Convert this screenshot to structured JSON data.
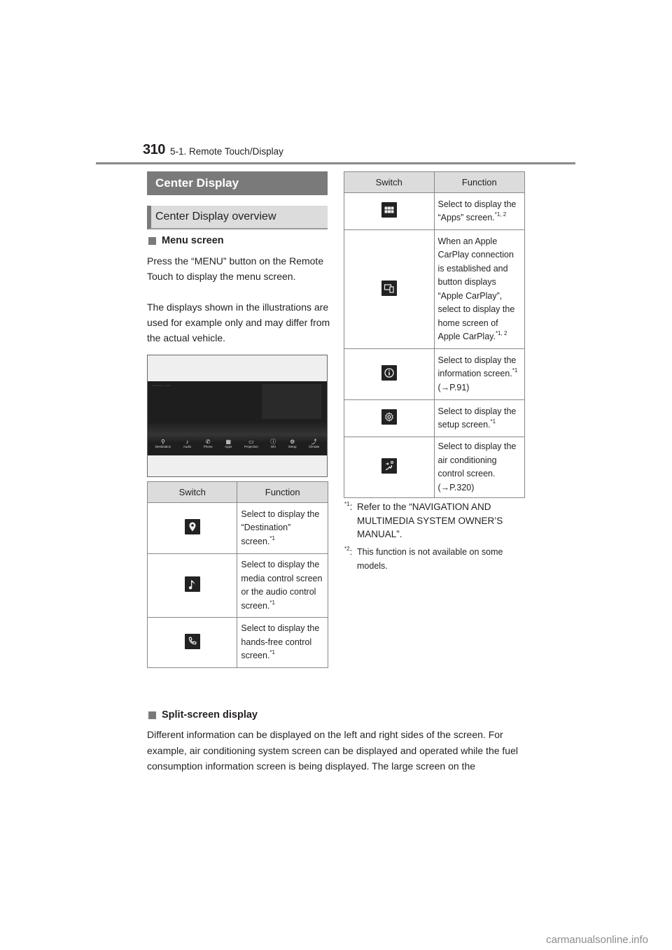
{
  "header": {
    "page_number": "310",
    "section": "5-1. Remote Touch/Display"
  },
  "headings": {
    "main": "Center Display",
    "sub": "Center Display overview"
  },
  "menu_screen": {
    "title": "Menu screen",
    "paragraph_1": "Press the “MENU” button on the Remote Touch to display the menu screen.",
    "paragraph_2": "The displays shown in the illustrations are used for example only and may differ from the actual vehicle.",
    "illustration": {
      "items": [
        {
          "label": "Destination",
          "icon": "pin-icon"
        },
        {
          "label": "Audio",
          "icon": "music-note-icon"
        },
        {
          "label": "Phone",
          "icon": "phone-icon"
        },
        {
          "label": "Apps",
          "icon": "apps-grid-icon"
        },
        {
          "label": "Projection",
          "icon": "projection-icon"
        },
        {
          "label": "Info",
          "icon": "info-icon"
        },
        {
          "label": "Setup",
          "icon": "gear-icon"
        },
        {
          "label": "Climate",
          "icon": "climate-seat-icon"
        }
      ]
    }
  },
  "table_left": {
    "headers": [
      "Switch",
      "Function"
    ],
    "rows": [
      {
        "icon": "pin-icon",
        "text": "Select to display the “Destination” screen.",
        "note": "*1"
      },
      {
        "icon": "music-note-icon",
        "text": "Select to display the media control screen or the audio control screen.",
        "note": "*1"
      },
      {
        "icon": "phone-icon",
        "text": "Select to display the hands-free control screen.",
        "note": "*1"
      }
    ]
  },
  "table_right": {
    "headers": [
      "Switch",
      "Function"
    ],
    "rows": [
      {
        "icon": "apps-grid-icon",
        "text": "Select to display the “Apps” screen.",
        "note": "*1, 2",
        "ref": ""
      },
      {
        "icon": "projection-icon",
        "text": "When an Apple CarPlay connection is established and button displays “Apple CarPlay”, select to display the home screen of Apple CarPlay.",
        "note": "*1, 2",
        "ref": ""
      },
      {
        "icon": "info-icon",
        "text": "Select to display the information screen.",
        "note": "*1",
        "ref": "(→P.91)"
      },
      {
        "icon": "gear-icon",
        "text": "Select to display the setup screen.",
        "note": "*1",
        "ref": ""
      },
      {
        "icon": "climate-seat-icon",
        "text": "Select to display the air conditioning control screen.",
        "note": "",
        "ref": "(→P.320)"
      }
    ]
  },
  "footnotes": [
    {
      "mark": "*1",
      "text": "Refer to the “NAVIGATION AND MULTIMEDIA SYSTEM OWNER’S MANUAL”."
    },
    {
      "mark": "*2",
      "text": "This function is not available on some models."
    }
  ],
  "split_screen": {
    "title": "Split-screen display",
    "paragraph": "Different information can be displayed on the left and right sides of the screen. For example, air conditioning system screen can be displayed and operated while the fuel consumption information screen is being displayed. The large screen on the"
  },
  "watermark": "carmanualsonline.info"
}
